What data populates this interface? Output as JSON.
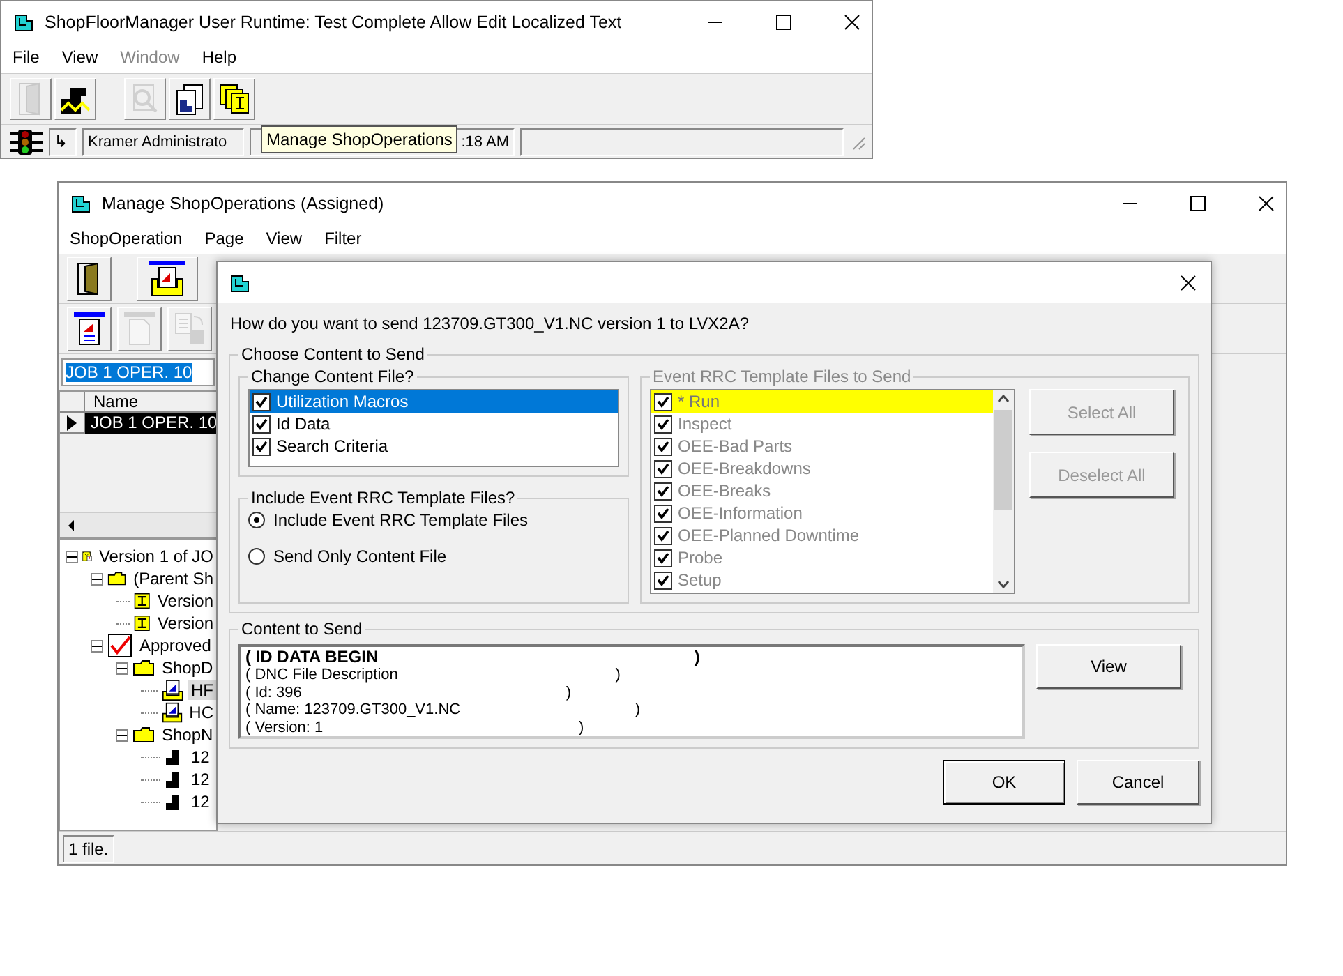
{
  "main_window": {
    "title": "ShopFloorManager User Runtime: Test Complete Allow Edit Localized Text",
    "menu": [
      {
        "label": "File",
        "disabled": false
      },
      {
        "label": "View",
        "disabled": false
      },
      {
        "label": "Window",
        "disabled": true
      },
      {
        "label": "Help",
        "disabled": false
      }
    ],
    "toolbar": [
      {
        "kind": "door",
        "disabled": true
      },
      {
        "kind": "machine",
        "disabled": false
      },
      {
        "kind": "inspect",
        "disabled": true
      },
      {
        "kind": "document",
        "disabled": false
      },
      {
        "kind": "stack",
        "disabled": false
      }
    ],
    "status_bar": {
      "arrow": "↳",
      "user": "Kramer Administrato",
      "time": ":18 AM"
    },
    "tooltip": "Manage ShopOperations"
  },
  "manage_window": {
    "title": "Manage ShopOperations (Assigned)",
    "menu": [
      {
        "label": "ShopOperation",
        "disabled": false
      },
      {
        "label": "Page",
        "disabled": false
      },
      {
        "label": "View",
        "disabled": false
      },
      {
        "label": "Filter",
        "disabled": false
      }
    ],
    "toolbar_rows": [
      [
        {
          "kind": "door",
          "disabled": false
        },
        {
          "kind": "printer",
          "disabled": false
        }
      ],
      [
        {
          "kind": "report",
          "disabled": false
        },
        {
          "kind": "blank",
          "disabled": true
        },
        {
          "kind": "copy",
          "disabled": true
        }
      ]
    ],
    "job_field": {
      "value": "JOB 1 OPER. 10"
    },
    "grid": {
      "columns": [
        "Name"
      ],
      "rows": [
        {
          "name": "JOB 1 OPER. 10",
          "selected": true
        }
      ]
    },
    "tree": [
      {
        "label": "Version 1 of JO",
        "kind": "version",
        "selected": false,
        "expanded": true,
        "children": [
          {
            "label": "(Parent Sh",
            "kind": "folder",
            "selected": false,
            "expanded": true,
            "children": [
              {
                "label": "Version",
                "kind": "file",
                "selected": false
              },
              {
                "label": "Version",
                "kind": "file",
                "selected": false
              }
            ]
          },
          {
            "label": "Approved",
            "kind": "approved",
            "selected": false,
            "expanded": true,
            "children": [
              {
                "label": "ShopD",
                "kind": "folder",
                "selected": false,
                "expanded": true,
                "children": [
                  {
                    "label": "HF",
                    "kind": "document",
                    "selected": true
                  },
                  {
                    "label": "HC",
                    "kind": "document",
                    "selected": false
                  }
                ]
              },
              {
                "label": "ShopN",
                "kind": "folder",
                "selected": false,
                "expanded": true,
                "children": [
                  {
                    "label": "12",
                    "kind": "machine",
                    "selected": false
                  },
                  {
                    "label": "12",
                    "kind": "machine",
                    "selected": false
                  },
                  {
                    "label": "12",
                    "kind": "machine",
                    "selected": false
                  }
                ]
              }
            ]
          }
        ]
      }
    ],
    "status_bar": "1 file."
  },
  "dialog": {
    "question": "How do you want to send 123709.GT300_V1.NC version 1 to LVX2A?",
    "choose_group": "Choose Content to Send",
    "content_files": {
      "label": "Change Content File?",
      "items": [
        {
          "label": "Utilization Macros",
          "checked": true,
          "selected": true
        },
        {
          "label": "Id Data",
          "checked": true,
          "selected": false
        },
        {
          "label": "Search Criteria",
          "checked": true,
          "selected": false
        }
      ]
    },
    "include_group": {
      "label": "Include Event RRC Template Files?",
      "options": [
        {
          "label": "Include Event RRC Template Files",
          "selected": true
        },
        {
          "label": "Send Only Content File",
          "selected": false
        }
      ]
    },
    "template_files": {
      "label": "Event RRC Template Files to Send",
      "disabled": true,
      "items": [
        {
          "label": "* Run",
          "checked": true,
          "selected": true
        },
        {
          "label": "Inspect",
          "checked": true,
          "selected": false
        },
        {
          "label": "OEE-Bad Parts",
          "checked": true,
          "selected": false
        },
        {
          "label": "OEE-Breakdowns",
          "checked": true,
          "selected": false
        },
        {
          "label": "OEE-Breaks",
          "checked": true,
          "selected": false
        },
        {
          "label": "OEE-Information",
          "checked": true,
          "selected": false
        },
        {
          "label": "OEE-Planned Downtime",
          "checked": true,
          "selected": false
        },
        {
          "label": "Probe",
          "checked": true,
          "selected": false
        },
        {
          "label": "Setup",
          "checked": true,
          "selected": false
        }
      ]
    },
    "side_buttons": [
      {
        "label": "Select All",
        "disabled": true
      },
      {
        "label": "Deselect All",
        "disabled": true
      }
    ],
    "content_group": {
      "label": "Content to Send",
      "lines": [
        {
          "text": "( ID DATA BEGIN                                                                    )",
          "bold": true
        },
        {
          "text": "( DNC File Description                                                   )",
          "bold": false
        },
        {
          "text": "( Id: 396                                                              )",
          "bold": false
        },
        {
          "text": "( Name: 123709.GT300_V1.NC                                         )",
          "bold": false
        },
        {
          "text": "( Version: 1                                                            )",
          "bold": false
        }
      ]
    },
    "view_button": "View",
    "buttons": [
      "OK",
      "Cancel"
    ]
  }
}
